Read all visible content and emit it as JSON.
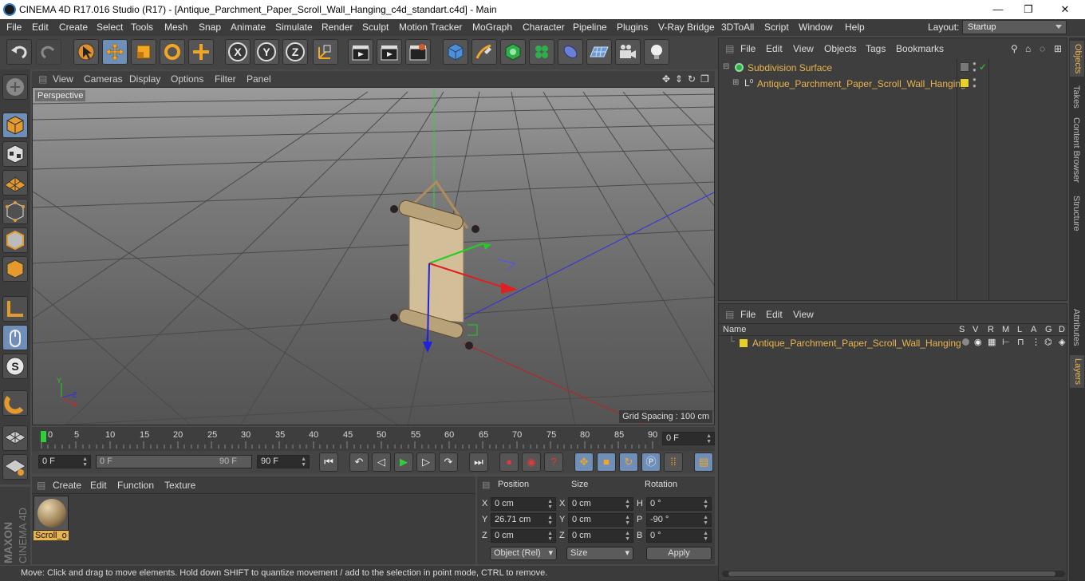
{
  "window": {
    "title": "CINEMA 4D R17.016 Studio (R17) - [Antique_Parchment_Paper_Scroll_Wall_Hanging_c4d_standart.c4d] - Main",
    "minimize": "—",
    "maximize": "❐",
    "close": "✕"
  },
  "menubar": {
    "items": [
      "File",
      "Edit",
      "Create",
      "Select",
      "Tools",
      "Mesh",
      "Snap",
      "Animate",
      "Simulate",
      "Render",
      "Sculpt",
      "Motion Tracker",
      "MoGraph",
      "Character",
      "Pipeline",
      "Plugins",
      "V-Ray Bridge",
      "3DToAll",
      "Script",
      "Window",
      "Help"
    ],
    "layout_label": "Layout:",
    "layout_value": "Startup"
  },
  "viewport": {
    "menu": [
      "View",
      "Cameras",
      "Display",
      "Options",
      "Filter",
      "Panel"
    ],
    "camera": "Perspective",
    "grid_spacing": "Grid Spacing : 100 cm",
    "axis_labels": {
      "y": "Y",
      "x": "X",
      "z": "Z"
    }
  },
  "timeline": {
    "ticks": [
      "0",
      "5",
      "10",
      "15",
      "20",
      "25",
      "30",
      "35",
      "40",
      "45",
      "50",
      "55",
      "60",
      "65",
      "70",
      "75",
      "80",
      "85",
      "90"
    ],
    "current_frame": "0 F"
  },
  "transport": {
    "start": "0 F",
    "range_start": "0 F",
    "range_end": "90 F",
    "end": "90 F"
  },
  "material_manager": {
    "menu": [
      "Create",
      "Edit",
      "Function",
      "Texture"
    ],
    "materials": [
      {
        "name": "Scroll_o"
      }
    ]
  },
  "coordinates": {
    "headers": {
      "position": "Position",
      "size": "Size",
      "rotation": "Rotation"
    },
    "rows": [
      {
        "axis": "X",
        "pos": "0 cm",
        "size_axis": "X",
        "size": "0 cm",
        "rot_axis": "H",
        "rot": "0 °"
      },
      {
        "axis": "Y",
        "pos": "26.71 cm",
        "size_axis": "Y",
        "size": "0 cm",
        "rot_axis": "P",
        "rot": "-90 °"
      },
      {
        "axis": "Z",
        "pos": "0 cm",
        "size_axis": "Z",
        "size": "0 cm",
        "rot_axis": "B",
        "rot": "0 °"
      }
    ],
    "mode": "Object (Rel)",
    "size_mode": "Size",
    "apply": "Apply"
  },
  "status": "Move: Click and drag to move elements. Hold down SHIFT to quantize movement / add to the selection in point mode, CTRL to remove.",
  "object_manager": {
    "menu": [
      "File",
      "Edit",
      "View",
      "Objects",
      "Tags",
      "Bookmarks"
    ],
    "objects": [
      {
        "name": "Subdivision Surface"
      },
      {
        "name": "Antique_Parchment_Paper_Scroll_Wall_Hanging"
      }
    ]
  },
  "layer_manager": {
    "menu": [
      "File",
      "Edit",
      "View"
    ],
    "columns": [
      "Name",
      "S",
      "V",
      "R",
      "M",
      "L",
      "A",
      "G",
      "D"
    ],
    "rows": [
      {
        "name": "Antique_Parchment_Paper_Scroll_Wall_Hanging"
      }
    ]
  },
  "side_tabs": [
    "Objects",
    "Takes",
    "Content Browser",
    "Structure",
    "Attributes",
    "Layers"
  ],
  "brand": {
    "line1": "MAXON",
    "line2": "CINEMA 4D"
  },
  "colors": {
    "accent": "#e9b44c",
    "selected_tool": "#6f8fb8",
    "layer_yellow": "#e8d026"
  }
}
